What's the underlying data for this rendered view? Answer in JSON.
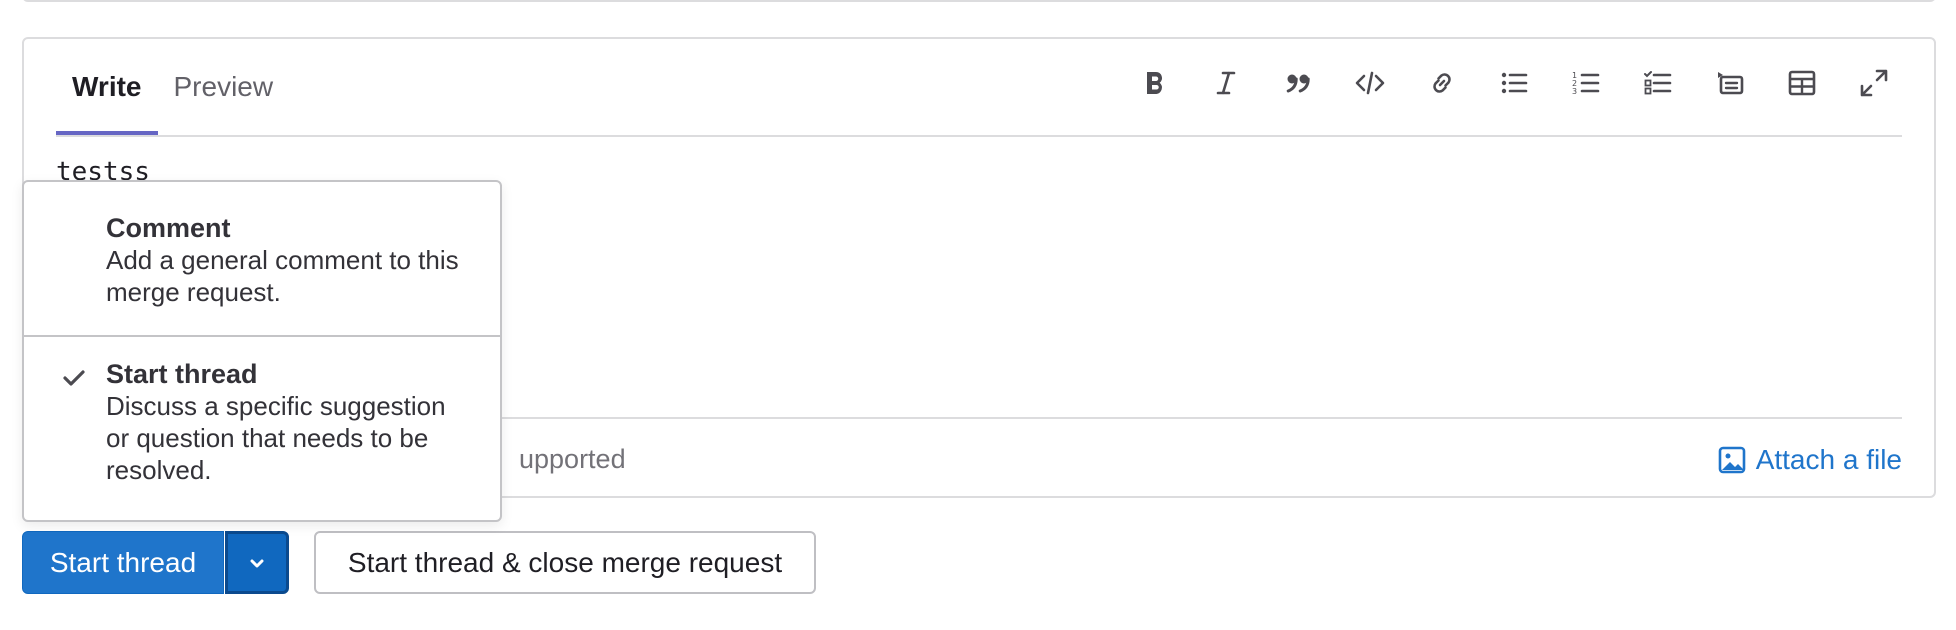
{
  "editor": {
    "tabs": [
      {
        "label": "Write",
        "active": true
      },
      {
        "label": "Preview",
        "active": false
      }
    ],
    "toolbar": [
      {
        "icon": "bold-icon"
      },
      {
        "icon": "italic-icon"
      },
      {
        "icon": "quote-icon"
      },
      {
        "icon": "code-icon"
      },
      {
        "icon": "link-icon"
      },
      {
        "icon": "bullet-list-icon"
      },
      {
        "icon": "numbered-list-icon"
      },
      {
        "icon": "task-list-icon"
      },
      {
        "icon": "collapsible-icon"
      },
      {
        "icon": "table-icon"
      },
      {
        "icon": "fullscreen-icon"
      }
    ],
    "text": "testss",
    "markdown_hint": "upported",
    "attach_label": "Attach a file"
  },
  "dropdown": {
    "items": [
      {
        "title": "Comment",
        "description": "Add a general comment to this merge request.",
        "selected": false
      },
      {
        "title": "Start thread",
        "description": "Discuss a specific suggestion or question that needs to be resolved.",
        "selected": true
      }
    ]
  },
  "actions": {
    "primary_label": "Start thread",
    "secondary_label": "Start thread & close merge request"
  },
  "colors": {
    "accent": "#1f75cb",
    "tab_underline": "#6666c4",
    "border": "#dcdcde"
  }
}
